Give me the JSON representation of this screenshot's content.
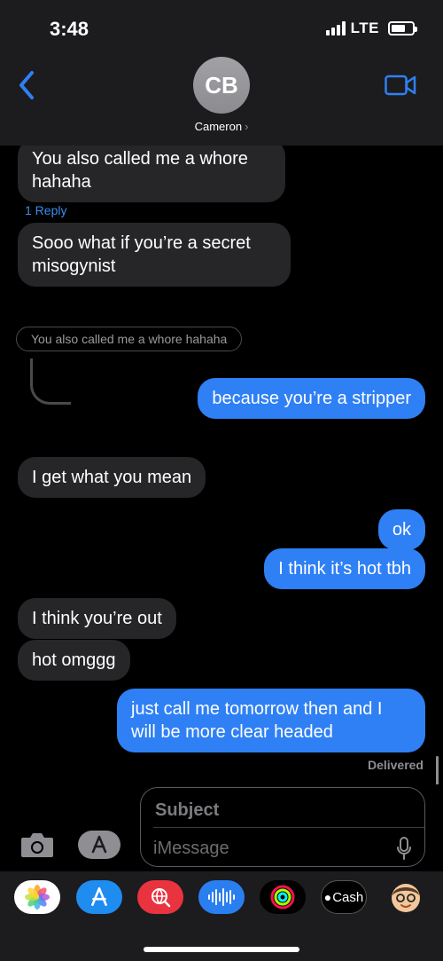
{
  "status": {
    "time": "3:48",
    "network": "LTE",
    "battery_percent": 70
  },
  "header": {
    "avatar_initials": "CB",
    "contact_name": "Cameron",
    "name_chevron": "›"
  },
  "thread": {
    "messages": [
      {
        "text": "You also called me a whore hahaha",
        "lines": [
          "You also called me a whore",
          "hahaha"
        ]
      },
      {
        "reply_count": "1 Reply"
      },
      {
        "text": "Sooo what if you’re a secret misogynist",
        "lines": [
          "Sooo what if you’re a secret",
          "misogynist"
        ]
      },
      {
        "quoted": "You also called me a whore hahaha"
      },
      {
        "text": "because you’re a stripper"
      },
      {
        "text": "I get what you mean"
      },
      {
        "text": "ok"
      },
      {
        "text": "I think it’s hot tbh"
      },
      {
        "text": "I think you’re out"
      },
      {
        "text": "hot omggg"
      },
      {
        "text": "just call me tomorrow then and I will be more clear headed",
        "lines": [
          "just call me tomorrow then and I",
          "will be more clear headed"
        ]
      }
    ],
    "delivered_label": "Delivered"
  },
  "composer": {
    "subject_placeholder": "Subject",
    "message_placeholder": "iMessage"
  },
  "app_drawer": {
    "apps": [
      "photos-app-icon",
      "app-store-icon",
      "web-images-icon",
      "audio-message-icon",
      "activity-icon",
      "apple-cash-icon",
      "memoji-icon"
    ],
    "cash_label": "Cash"
  },
  "colors": {
    "outgoing": "#2f80f5",
    "incoming": "#262628",
    "accent": "#3b8ef0"
  }
}
